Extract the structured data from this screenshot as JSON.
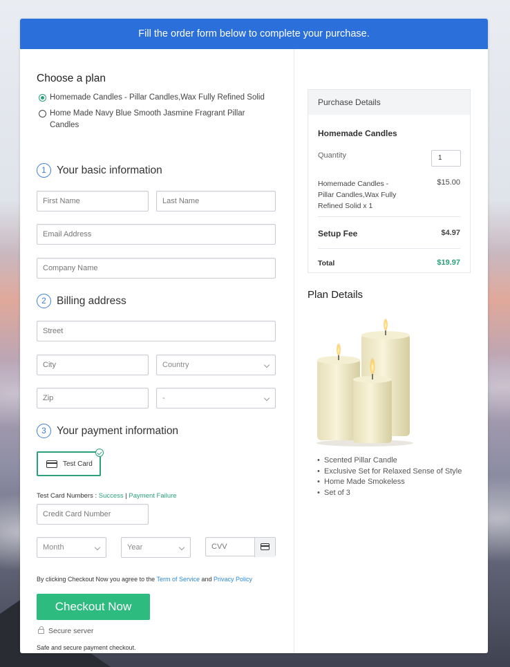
{
  "banner": "Fill the order form below to complete your purchase.",
  "plan": {
    "heading": "Choose a plan",
    "options": [
      {
        "label": "Homemade Candles - Pillar Candles,Wax Fully Refined Solid",
        "selected": true
      },
      {
        "label": "Home Made Navy Blue Smooth Jasmine Fragrant Pillar Candles",
        "selected": false
      }
    ]
  },
  "basic": {
    "num": "1",
    "heading": "Your basic information",
    "first_name": "First Name",
    "last_name": "Last Name",
    "email": "Email Address",
    "company": "Company Name"
  },
  "billing": {
    "num": "2",
    "heading": "Billing address",
    "street": "Street",
    "city": "City",
    "country": "Country",
    "zip": "Zip",
    "state": "-"
  },
  "payment": {
    "num": "3",
    "heading": "Your payment information",
    "test_card": "Test Card",
    "test_numbers_label": "Test Card Numbers :",
    "success": "Success",
    "sep": "|",
    "failure": "Payment Failure",
    "card_number": "Credit Card Number",
    "month": "Month",
    "year": "Year",
    "cvv": "CVV"
  },
  "terms": {
    "prefix": "By clicking Checkout Now you agree to the",
    "tos": "Term of Service",
    "and": "and",
    "privacy": "Privacy Policy"
  },
  "checkout": {
    "button": "Checkout Now",
    "secure": "Secure server",
    "note": "Safe and secure payment checkout."
  },
  "purchase": {
    "heading": "Purchase Details",
    "product": "Homemade Candles",
    "quantity_label": "Quantity",
    "quantity": "1",
    "item": "Homemade Candles - Pillar Candles,Wax Fully Refined Solid x 1",
    "item_price": "$15.00",
    "setup_label": "Setup Fee",
    "setup_price": "$4.97",
    "total_label": "Total",
    "total_price": "$19.97"
  },
  "plan_details": {
    "heading": "Plan Details",
    "features": [
      "Scented Pillar Candle",
      "Exclusive Set for Relaxed Sense of Style",
      "Home Made Smokeless",
      "Set of 3"
    ]
  },
  "colors": {
    "banner": "#2b6fdb",
    "accent": "#2aa07a",
    "button": "#2dbb7f",
    "link": "#2b8ad6"
  }
}
